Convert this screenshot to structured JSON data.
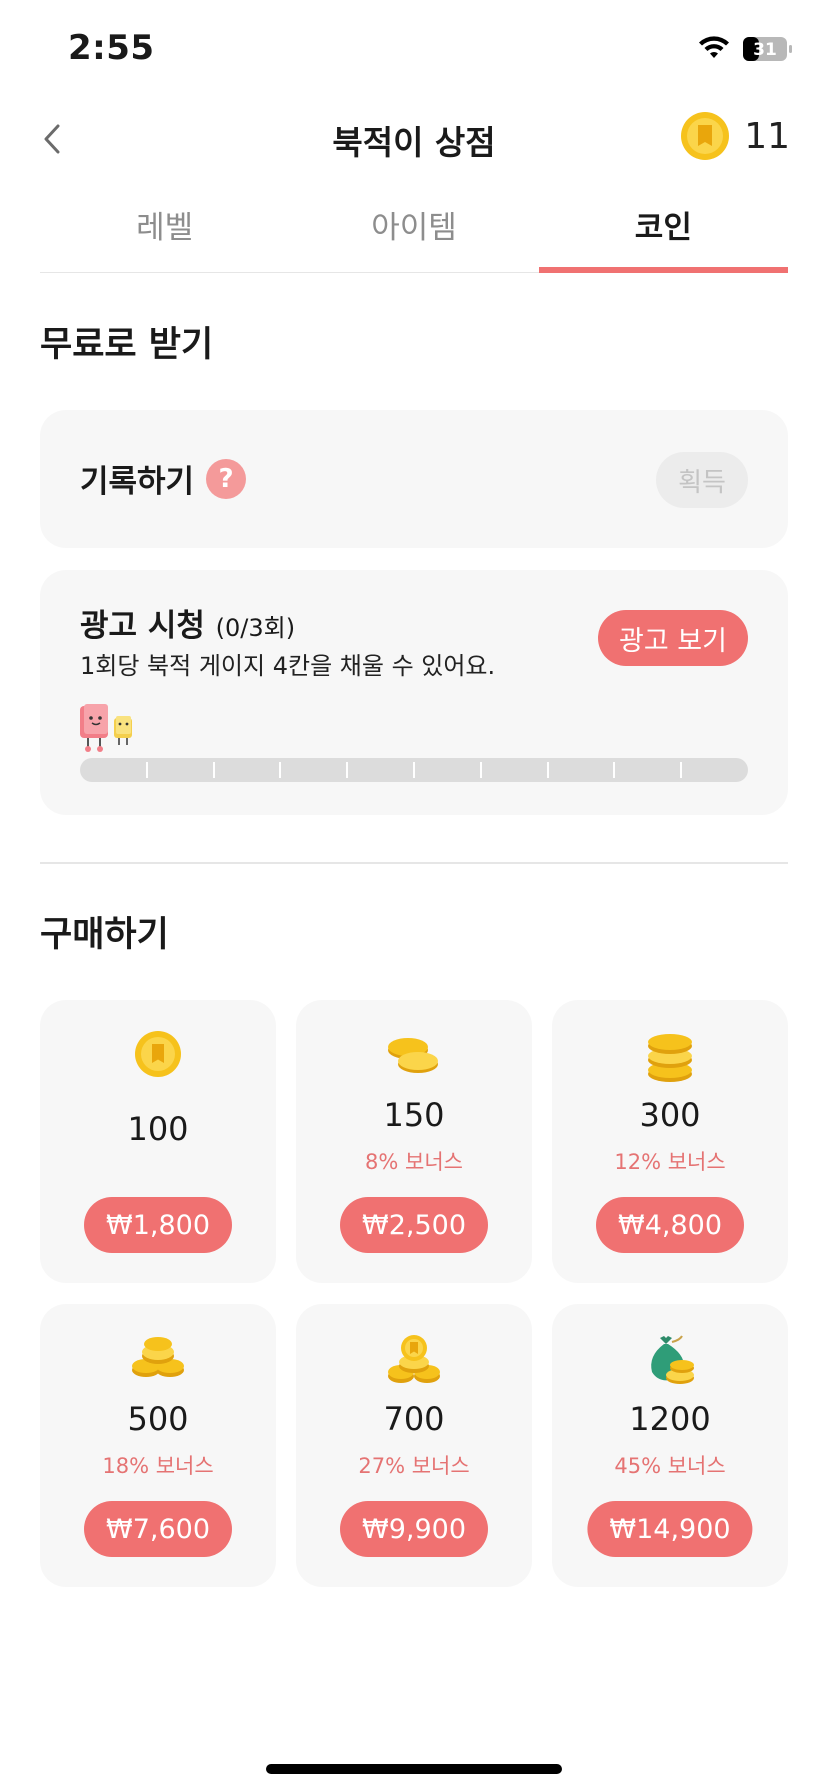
{
  "status_bar": {
    "time": "2:55",
    "battery": "31"
  },
  "header": {
    "title": "북적이 상점",
    "coin_balance": "11"
  },
  "tabs": [
    {
      "label": "레벨"
    },
    {
      "label": "아이템"
    },
    {
      "label": "코인",
      "active": true
    }
  ],
  "free_section": {
    "title": "무료로 받기",
    "record": {
      "label": "기록하기",
      "help": "?",
      "button": "획득"
    },
    "ad": {
      "label": "광고 시청",
      "count": "(0/3회)",
      "description": "1회당 북적 게이지 4칸을 채울 수 있어요.",
      "button": "광고 보기",
      "gauge_filled": 0,
      "gauge_total": 10
    }
  },
  "purchase_section": {
    "title": "구매하기",
    "products": [
      {
        "amount": "100",
        "bonus": "",
        "price": "₩1,800",
        "icon": "single-coin-icon"
      },
      {
        "amount": "150",
        "bonus": "8% 보너스",
        "price": "₩2,500",
        "icon": "two-coins-icon"
      },
      {
        "amount": "300",
        "bonus": "12% 보너스",
        "price": "₩4,800",
        "icon": "coin-stack-icon"
      },
      {
        "amount": "500",
        "bonus": "18% 보너스",
        "price": "₩7,600",
        "icon": "coin-pile-icon"
      },
      {
        "amount": "700",
        "bonus": "27% 보너스",
        "price": "₩9,900",
        "icon": "coin-heap-icon"
      },
      {
        "amount": "1200",
        "bonus": "45% 보너스",
        "price": "₩14,900",
        "icon": "money-bag-icon"
      }
    ]
  },
  "colors": {
    "accent": "#f07171",
    "bonus_text": "#e57373",
    "card_bg": "#f7f7f7",
    "coin_gold": "#f6c21c"
  }
}
